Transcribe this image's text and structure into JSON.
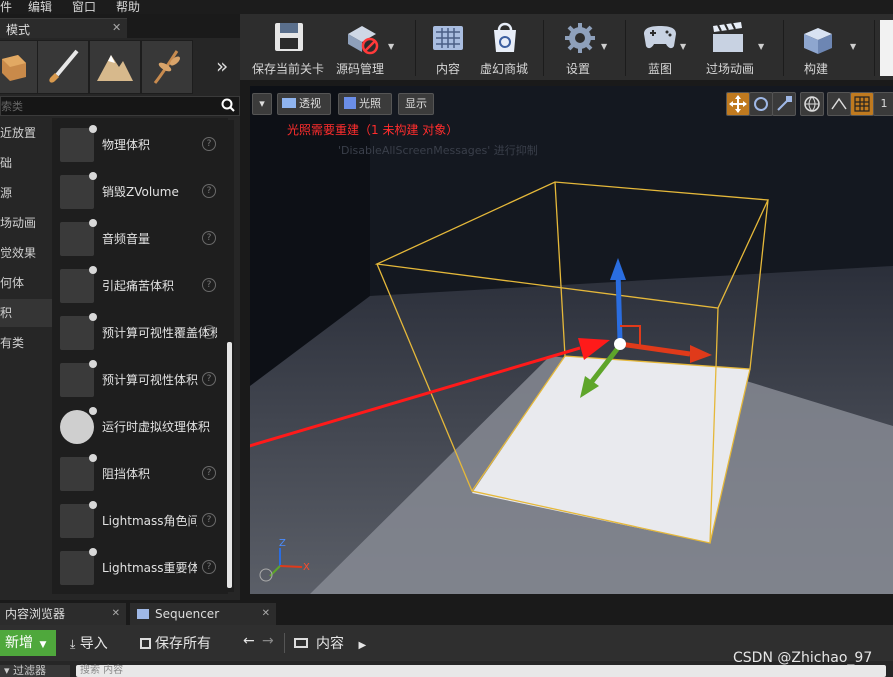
{
  "menu": {
    "items": [
      "件",
      "编辑",
      "窗口",
      "帮助"
    ]
  },
  "modes": {
    "tab_label": "模式",
    "tab_close": "✕",
    "search_placeholder": "索类",
    "more_glyph": "»",
    "categories": [
      {
        "label": "近放置",
        "selected": false
      },
      {
        "label": "础",
        "selected": false
      },
      {
        "label": "源",
        "selected": false
      },
      {
        "label": "场动画",
        "selected": false
      },
      {
        "label": "觉效果",
        "selected": false
      },
      {
        "label": "何体",
        "selected": false
      },
      {
        "label": "积",
        "selected": true
      },
      {
        "label": "有类",
        "selected": false
      }
    ],
    "items": [
      {
        "label": "物理体积",
        "icon": "physics-volume-icon"
      },
      {
        "label": "销毁ZVolume",
        "icon": "kill-z-volume-icon"
      },
      {
        "label": "音频音量",
        "icon": "audio-volume-icon"
      },
      {
        "label": "引起痛苦体积",
        "icon": "pain-volume-icon"
      },
      {
        "label": "预计算可视性覆盖体积",
        "icon": "precomputed-visibility-override-icon"
      },
      {
        "label": "预计算可视性体积",
        "icon": "precomputed-visibility-volume-icon"
      },
      {
        "label": "运行时虚拟纹理体积",
        "icon": "runtime-virtual-texture-icon"
      },
      {
        "label": "阻挡体积",
        "icon": "blocking-volume-icon"
      },
      {
        "label": "Lightmass角色间接光照体积",
        "icon": "lightmass-character-icon"
      },
      {
        "label": "Lightmass重要体积",
        "icon": "lightmass-importance-icon"
      }
    ],
    "help_glyph": "?"
  },
  "toolbar": {
    "items": [
      {
        "label": "保存当前关卡",
        "icon": "save-icon"
      },
      {
        "label": "源码管理",
        "icon": "source-control-icon"
      },
      {
        "label": "内容",
        "icon": "content-icon"
      },
      {
        "label": "虚幻商城",
        "icon": "marketplace-icon"
      },
      {
        "label": "设置",
        "icon": "settings-icon"
      },
      {
        "label": "蓝图",
        "icon": "blueprint-icon"
      },
      {
        "label": "过场动画",
        "icon": "cinematics-icon"
      },
      {
        "label": "构建",
        "icon": "build-icon"
      }
    ]
  },
  "viewport": {
    "view_menu_glyph": "▾",
    "perspective_label": "透视",
    "lit_label": "光照",
    "show_label": "显示",
    "warning": "光照需要重建（1 未构建 对象）",
    "warning_faded": "'DisableAllScreenMessages' 进行抑制",
    "grid_value": "1",
    "axis_x": "X",
    "axis_z": "Z"
  },
  "bottom": {
    "tabs": [
      {
        "label": "内容浏览器",
        "icon": "content-browser-icon"
      },
      {
        "label": "Sequencer",
        "icon": "sequencer-icon"
      }
    ],
    "new_label": "新增",
    "import_label": "导入",
    "save_all_label": "保存所有",
    "path_label": "内容",
    "filter_label": "过滤器",
    "search_placeholder": "搜索 内容"
  },
  "watermark": "CSDN @Zhichao_97",
  "colors": {
    "accent_green": "#4fa83c",
    "warning_red": "#ff2d2d",
    "selection_box": "#e5b83a",
    "annotation_arrow": "#ff1a1a"
  }
}
